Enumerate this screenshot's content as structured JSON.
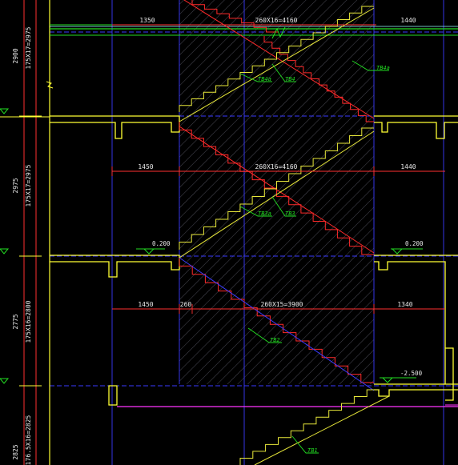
{
  "colors": {
    "background": "#000000",
    "slab": "#ffff33",
    "stair_red": "#ff2a2a",
    "stair_yellow": "#e8e83a",
    "axis_blue": "#3a3aff",
    "dim_red": "#ff3030",
    "dim_text": "#e8e8e8",
    "tag_green": "#22dd22",
    "hatch": "#6a6a7a",
    "magenta": "#ff33ff"
  },
  "dimensions": {
    "top": {
      "left": "1350",
      "middle": "260X16=4160",
      "right": "1440"
    },
    "mid": {
      "left": "1450",
      "middle": "260X16=4160",
      "right": "1440"
    },
    "bottom": {
      "left": "1450",
      "landing": "260",
      "middle": "260X15=3900",
      "right": "1340"
    }
  },
  "level_marks": {
    "left_upper": "0.200",
    "right_upper": "0.200",
    "right_lower": "-2.500"
  },
  "tags": {
    "upper_a": "TB4a",
    "upper_b": "TB4",
    "mid_a": "TB3a",
    "mid_b": "TB3",
    "lower": "TB2",
    "bottom": "TB1",
    "top_right": "TB4a"
  },
  "vertical_dims": {
    "top": {
      "height": "2900",
      "steps": "175X17=2975"
    },
    "mid": {
      "height": "2975",
      "steps": "175X17=2975"
    },
    "low": {
      "height": "2775",
      "steps": "175X16=2800"
    },
    "bottom": {
      "height": "2825",
      "steps": "176.5X16=2825"
    }
  }
}
